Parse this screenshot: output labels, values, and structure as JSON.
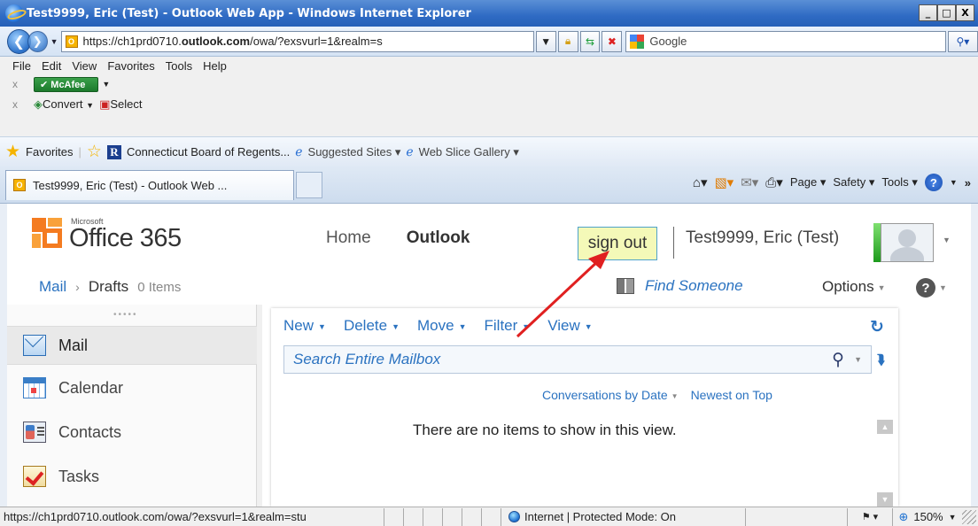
{
  "window": {
    "title": "Test9999, Eric (Test) - Outlook Web App - Windows Internet Explorer",
    "min": "_",
    "max": "□",
    "close": "X"
  },
  "address": {
    "url_prefix": "https://ch1prd0710.",
    "url_bold": "outlook.com",
    "url_suffix": "/owa/?exsvurl=1&realm=s",
    "favicon": "O",
    "search_engine": "Google"
  },
  "menu": [
    "File",
    "Edit",
    "View",
    "Favorites",
    "Tools",
    "Help"
  ],
  "toolbars": {
    "mcafee": "McAfee",
    "convert": "Convert",
    "select": "Select"
  },
  "favorites_bar": {
    "favorites": "Favorites",
    "link1": "Connecticut Board of Regents...",
    "suggested": "Suggested Sites",
    "web_slice": "Web Slice Gallery"
  },
  "tab": {
    "label": "Test9999, Eric (Test) - Outlook Web ..."
  },
  "commandbar": {
    "page": "Page",
    "safety": "Safety",
    "tools": "Tools"
  },
  "owa": {
    "logo_small": "Microsoft",
    "logo_text": "Office 365",
    "nav_home": "Home",
    "nav_outlook": "Outlook",
    "sign_out": "sign out",
    "user_name": "Test9999, Eric (Test)",
    "breadcrumb_mail": "Mail",
    "breadcrumb_folder": "Drafts",
    "breadcrumb_count": "0 Items",
    "find_someone": "Find Someone",
    "options": "Options",
    "left_nav": [
      {
        "label": "Mail"
      },
      {
        "label": "Calendar"
      },
      {
        "label": "Contacts"
      },
      {
        "label": "Tasks"
      }
    ],
    "actions": [
      "New",
      "Delete",
      "Move",
      "Filter",
      "View"
    ],
    "search_placeholder": "Search Entire Mailbox",
    "sort_by": "Conversations by Date",
    "sort_order": "Newest on Top",
    "empty_message": "There are no items to show in this view."
  },
  "status": {
    "url": "https://ch1prd0710.outlook.com/owa/?exsvurl=1&realm=stu",
    "zone": "Internet | Protected Mode: On",
    "zoom": "150%"
  },
  "colors": {
    "accent": "#2a72c0",
    "signout_bg": "#f4f9b8",
    "arrow": "#e02020"
  }
}
